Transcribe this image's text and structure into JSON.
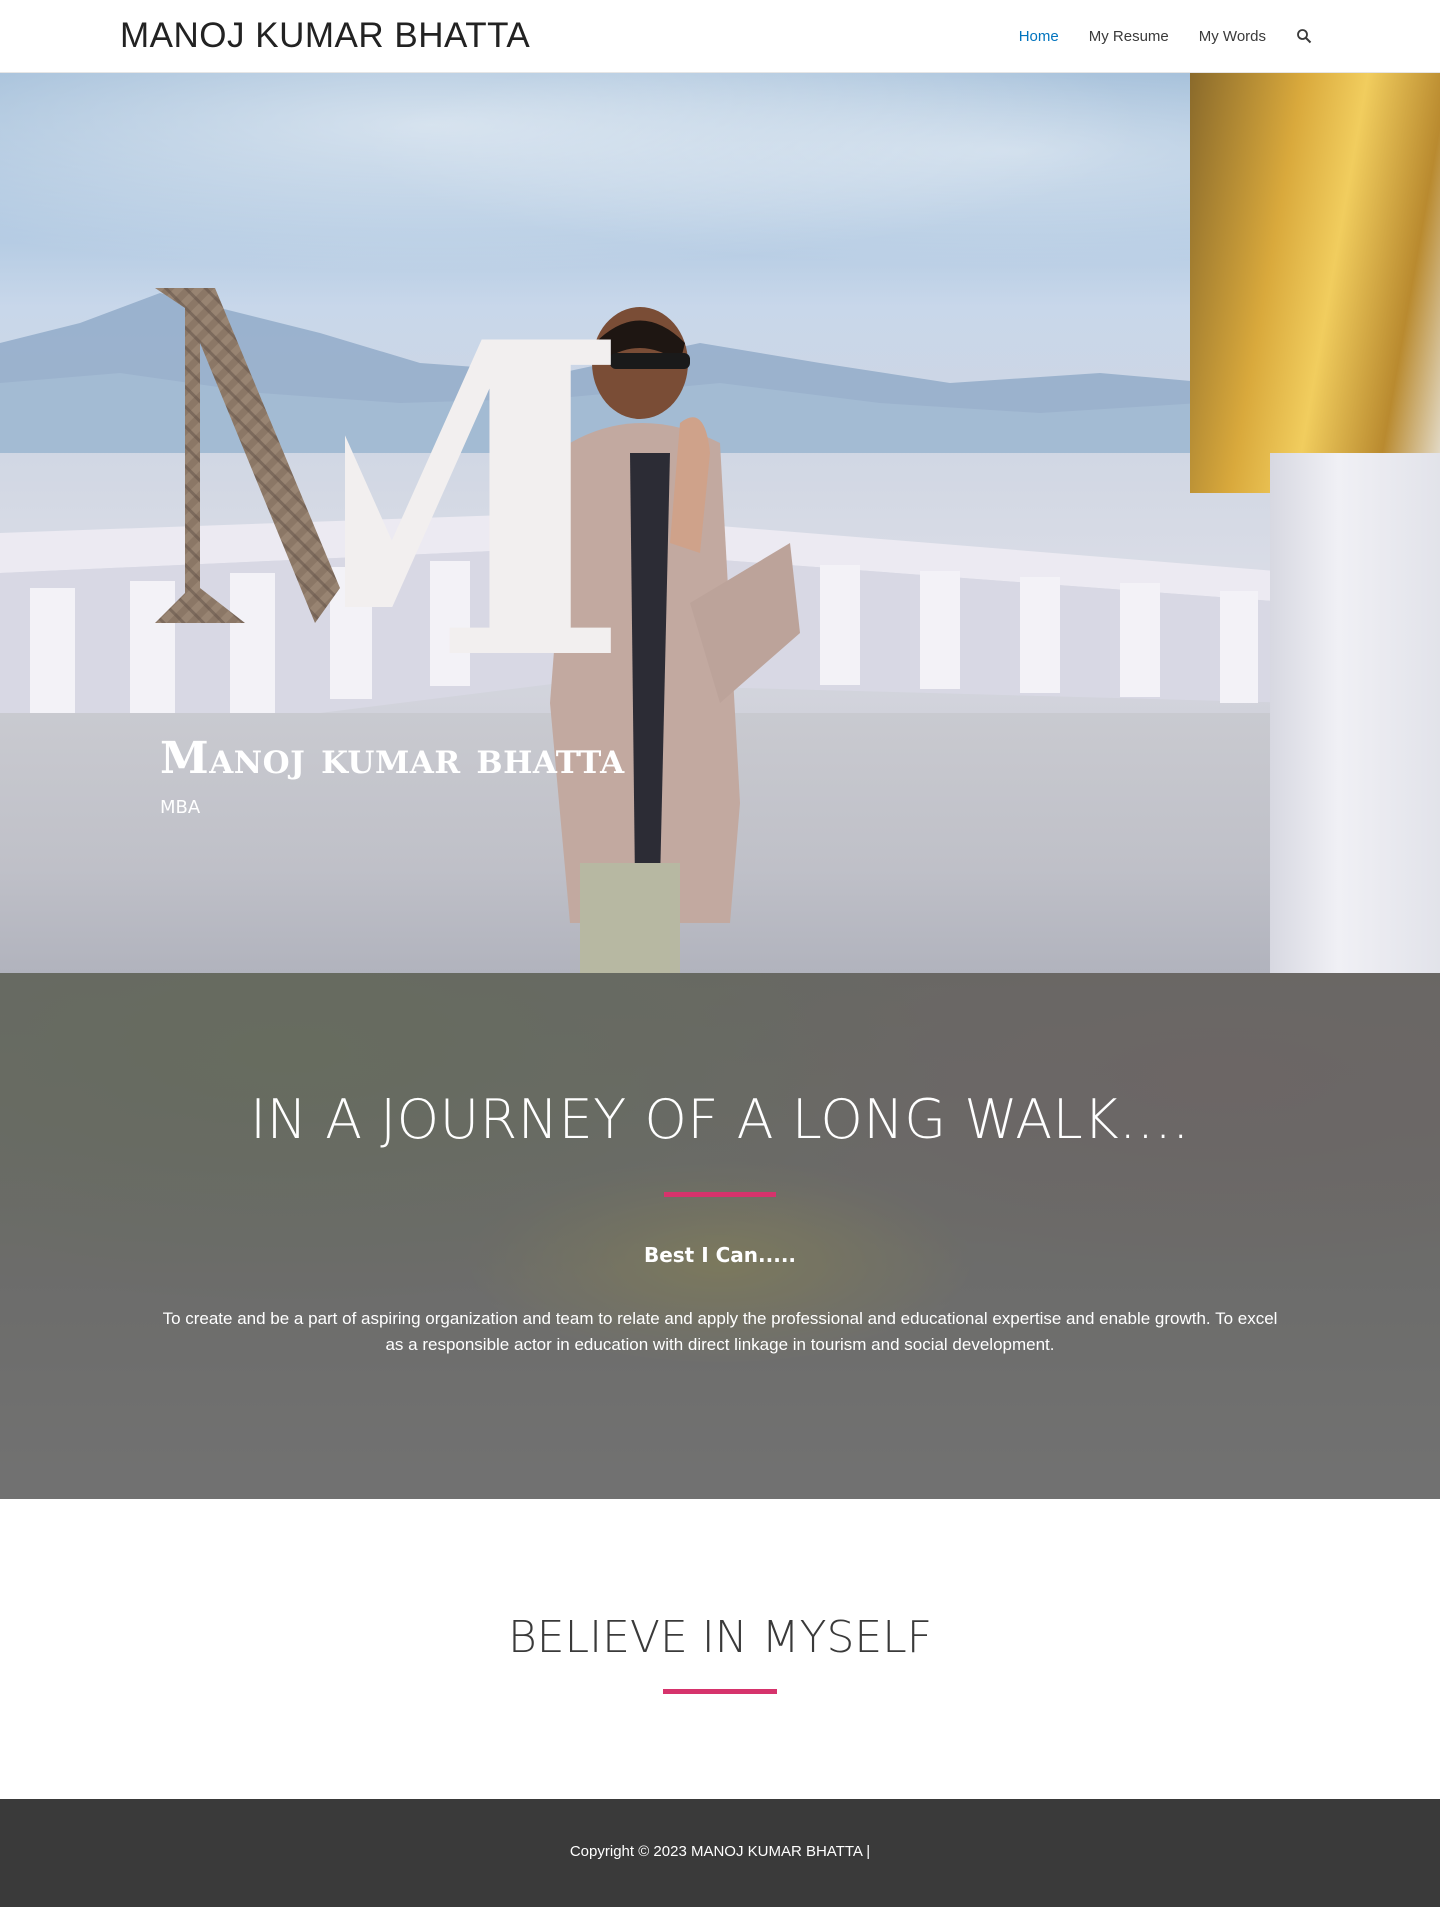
{
  "header": {
    "site_title": "MANOJ KUMAR BHATTA",
    "nav": [
      {
        "label": "Home",
        "active": true
      },
      {
        "label": "My Resume",
        "active": false
      },
      {
        "label": "My Words",
        "active": false
      }
    ],
    "search_icon": "search-icon",
    "active_color": "#0274be"
  },
  "hero": {
    "monogram": "M",
    "name": "Manoj kumar bhatta",
    "subtitle": "MBA"
  },
  "journey": {
    "title": "IN A JOURNEY OF A LONG WALK....",
    "subtitle": "Best I Can.....",
    "text": "To create and be a part of aspiring organization and team to relate and apply the professional and educational expertise and enable growth. To excel as a responsible actor in education with direct linkage in tourism and social development.",
    "accent_color": "#d6336c"
  },
  "believe": {
    "title": "BELIEVE IN MYSELF"
  },
  "footer": {
    "copyright": "Copyright © 2023 MANOJ KUMAR BHATTA |"
  }
}
